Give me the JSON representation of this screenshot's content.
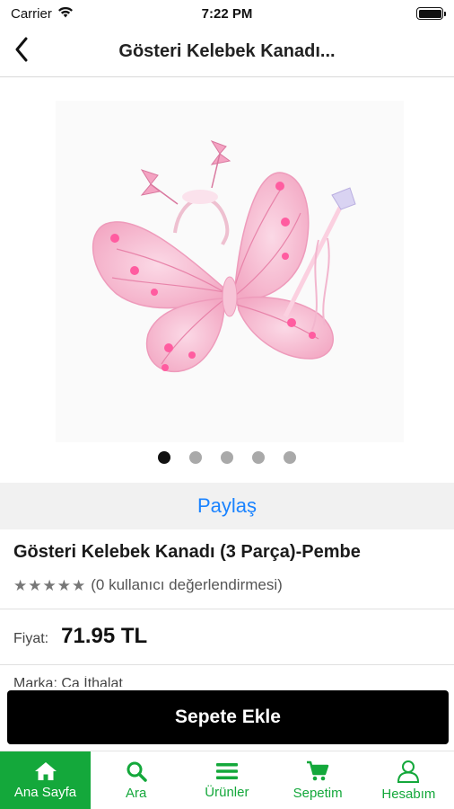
{
  "status_bar": {
    "carrier": "Carrier",
    "time": "7:22 PM",
    "battery_level": 1.0
  },
  "nav": {
    "back_icon": "chevron-left-icon",
    "title": "Gösteri Kelebek Kanadı..."
  },
  "gallery": {
    "image_count": 5,
    "active_index": 0
  },
  "share": {
    "label": "Paylaş"
  },
  "product": {
    "name": "Gösteri Kelebek Kanadı (3 Parça)-Pembe",
    "rating_stars": 5,
    "rating_text": "(0 kullanıcı değerlendirmesi)",
    "price_label": "Fiyat:",
    "price": "71.95 TL",
    "brand_partial": "Marka: Ca İthalat"
  },
  "cta": {
    "add_to_cart": "Sepete Ekle"
  },
  "tabs": [
    {
      "label": "Ana Sayfa",
      "icon": "home-icon",
      "active": true
    },
    {
      "label": "Ara",
      "icon": "search-icon",
      "active": false
    },
    {
      "label": "Ürünler",
      "icon": "menu-icon",
      "active": false
    },
    {
      "label": "Sepetim",
      "icon": "cart-icon",
      "active": false
    },
    {
      "label": "Hesabım",
      "icon": "user-icon",
      "active": false
    }
  ],
  "colors": {
    "accent_green": "#14a83b",
    "link_blue": "#1a83ff",
    "cta_black": "#000000",
    "wing_pink": "#f6b9cf"
  }
}
